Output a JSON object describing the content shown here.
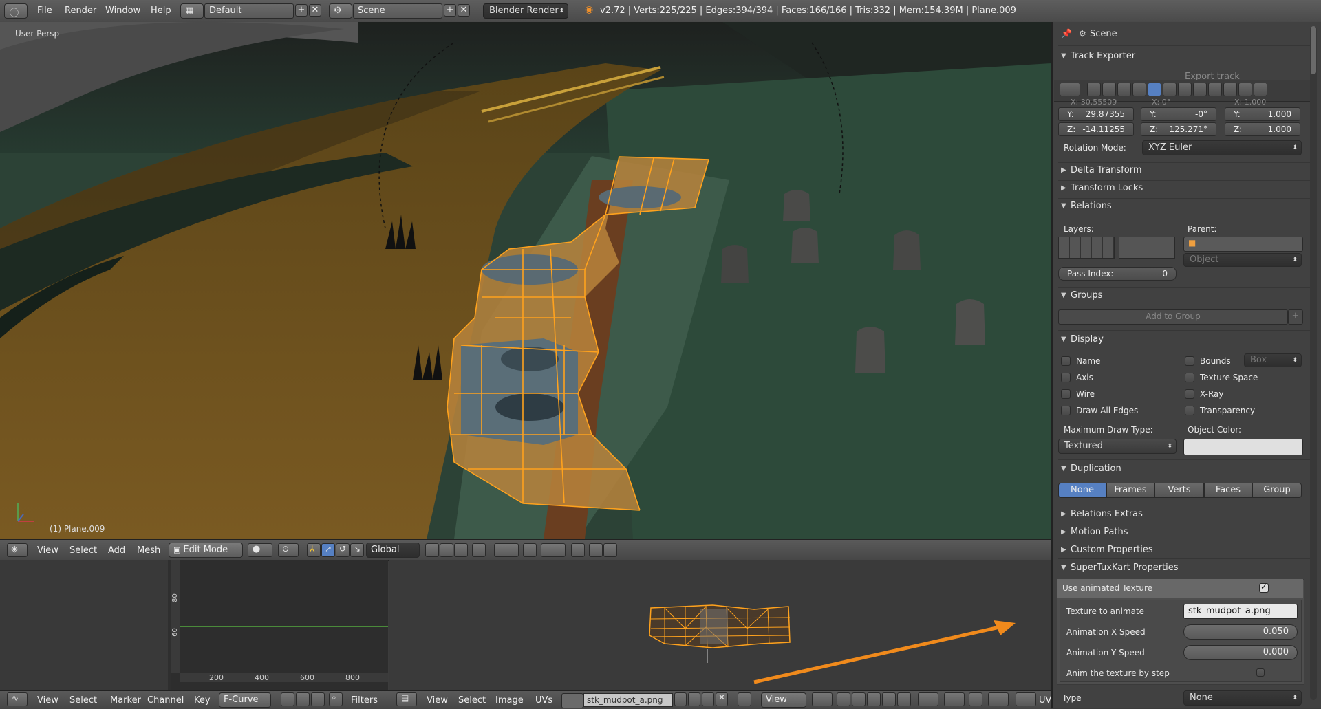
{
  "topbar": {
    "menu": [
      "File",
      "Render",
      "Window",
      "Help"
    ],
    "layout_name": "Default",
    "scene_name": "Scene",
    "render_engine": "Blender Render",
    "stats": "v2.72 | Verts:225/225 | Edges:394/394 | Faces:166/166 | Tris:332 | Mem:154.39M | Plane.009"
  },
  "viewport": {
    "perspective_label": "User Persp",
    "object_label": "(1) Plane.009"
  },
  "viewport_header": {
    "menu": [
      "View",
      "Select",
      "Add",
      "Mesh"
    ],
    "mode": "Edit Mode",
    "orientation": "Global"
  },
  "graph": {
    "y_ticks": [
      "80",
      "60"
    ],
    "x_ticks": [
      "200",
      "400",
      "600",
      "800"
    ]
  },
  "bottombar": {
    "graph_menu": [
      "View",
      "Select",
      "Marker",
      "Channel",
      "Key"
    ],
    "fcurve_mode": "F-Curve",
    "filters": "Filters",
    "uv_menu": [
      "View",
      "Select",
      "Image",
      "UVs"
    ],
    "image_name": "stk_mudpot_a.png",
    "view_label": "View",
    "uv_trailing": "UV"
  },
  "properties": {
    "breadcrumb": "Scene",
    "track_exporter": "Track Exporter",
    "export_track": "Export track",
    "location_x_partial": "X:  30.55509",
    "rotation_x_partial": "X:  0°",
    "scale_x_partial": "X:  1.000",
    "loc": [
      {
        "axis": "Y:",
        "value": "29.87355"
      },
      {
        "axis": "Z:",
        "value": "-14.11255"
      }
    ],
    "rot": [
      {
        "axis": "Y:",
        "value": "-0°"
      },
      {
        "axis": "Z:",
        "value": "125.271°"
      }
    ],
    "scale": [
      {
        "axis": "Y:",
        "value": "1.000"
      },
      {
        "axis": "Z:",
        "value": "1.000"
      }
    ],
    "rotation_mode_label": "Rotation Mode:",
    "rotation_mode": "XYZ Euler",
    "delta_transform": "Delta Transform",
    "transform_locks": "Transform Locks",
    "relations": "Relations",
    "layers_label": "Layers:",
    "parent_label": "Parent:",
    "parent_type": "Object",
    "pass_index_label": "Pass Index:",
    "pass_index": "0",
    "groups": "Groups",
    "add_to_group": "Add to Group",
    "display": "Display",
    "display_left": [
      "Name",
      "Axis",
      "Wire",
      "Draw All Edges"
    ],
    "display_right": [
      "Bounds",
      "Texture Space",
      "X-Ray",
      "Transparency"
    ],
    "bounds_type": "Box",
    "max_draw_type_label": "Maximum Draw Type:",
    "max_draw_type": "Textured",
    "object_color_label": "Object Color:",
    "duplication": "Duplication",
    "dup_tabs": [
      "None",
      "Frames",
      "Verts",
      "Faces",
      "Group"
    ],
    "relations_extras": "Relations Extras",
    "motion_paths": "Motion Paths",
    "custom_properties": "Custom Properties",
    "stk_properties": "SuperTuxKart Properties",
    "use_animated_texture": "Use animated Texture",
    "texture_to_animate_label": "Texture to animate",
    "texture_to_animate": "stk_mudpot_a.png",
    "anim_x_label": "Animation X Speed",
    "anim_x": "0.050",
    "anim_y_label": "Animation Y Speed",
    "anim_y": "0.000",
    "anim_by_step_label": "Anim the texture by step",
    "type_label": "Type",
    "type_value": "None"
  },
  "colors": {
    "selection_orange": "#ffa21d",
    "arrow_orange": "#f08a1c",
    "active_blue": "#5680c2"
  }
}
